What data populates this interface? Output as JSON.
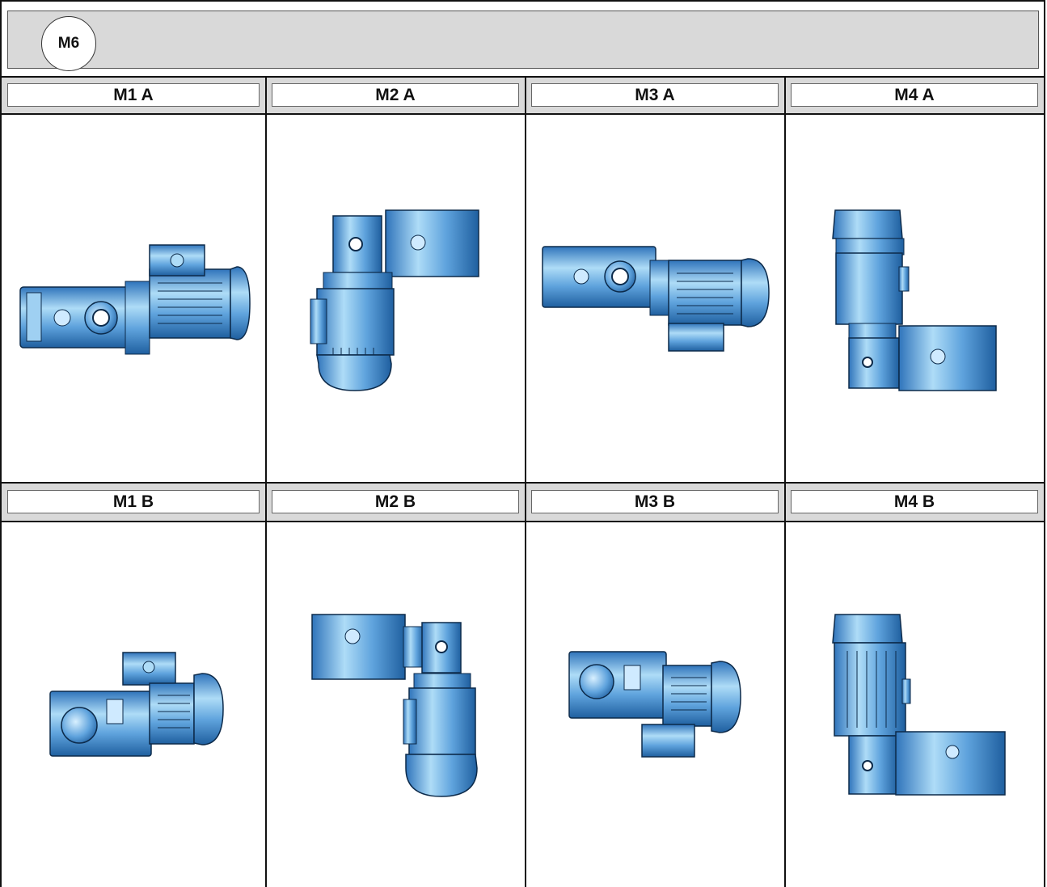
{
  "header": {
    "badge": "M6"
  },
  "labels": {
    "m1a": "M1 A",
    "m2a": "M2 A",
    "m3a": "M3 A",
    "m4a": "M4 A",
    "m1b": "M1 B",
    "m2b": "M2 B",
    "m3b": "M3 B",
    "m4b": "M4 B"
  },
  "colors": {
    "housing": "#4f93d4",
    "highlight": "#aedcf7",
    "shadow": "#1f5f9f",
    "outline": "#0c2a4a",
    "header_band": "#d9d9d9"
  }
}
